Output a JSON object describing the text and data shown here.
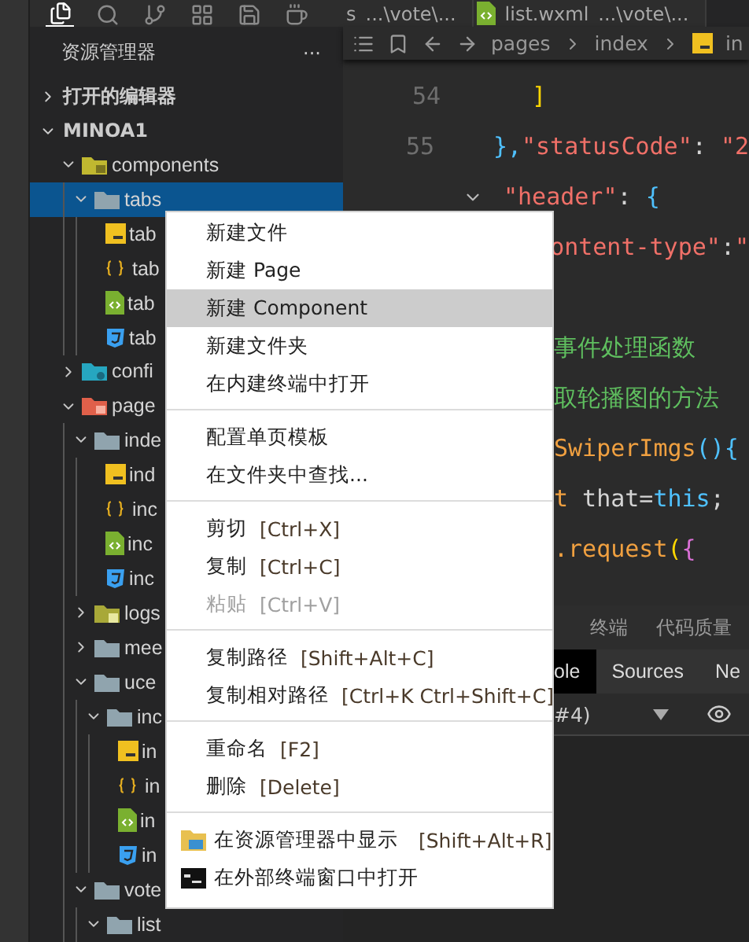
{
  "sidebar": {
    "toolbar": [
      {
        "kind": "files",
        "selected": true
      },
      {
        "kind": "search",
        "selected": false
      },
      {
        "kind": "git",
        "selected": false
      },
      {
        "kind": "extensions",
        "selected": false
      },
      {
        "kind": "save",
        "selected": false
      },
      {
        "kind": "cup",
        "selected": false
      }
    ],
    "title": "资源管理器",
    "more": "···",
    "sections": [
      {
        "label": "打开的编辑器",
        "expanded": false
      },
      {
        "label": "MINOA1",
        "expanded": true
      }
    ],
    "tree": [
      {
        "label": "components",
        "kind": "folder-components",
        "expanded": true,
        "selected": false,
        "children": [
          {
            "label": "tabs",
            "kind": "folder",
            "expanded": true,
            "selected": true,
            "children": [
              {
                "label": "tab",
                "kind": "js",
                "selected": false
              },
              {
                "label": "tab",
                "kind": "json",
                "selected": false
              },
              {
                "label": "tab",
                "kind": "wxml",
                "selected": false
              },
              {
                "label": "tab",
                "kind": "wxss",
                "selected": false
              }
            ]
          }
        ]
      },
      {
        "label": "confi",
        "kind": "folder-config",
        "expanded": false,
        "selected": false
      },
      {
        "label": "page",
        "kind": "folder-pages",
        "expanded": true,
        "selected": false,
        "children": [
          {
            "label": "inde",
            "kind": "folder",
            "expanded": true,
            "selected": false,
            "children": [
              {
                "label": "ind",
                "kind": "js",
                "selected": false
              },
              {
                "label": "inc",
                "kind": "json",
                "selected": false
              },
              {
                "label": "inc",
                "kind": "wxml",
                "selected": false
              },
              {
                "label": "inc",
                "kind": "wxss",
                "selected": false
              }
            ]
          },
          {
            "label": "logs",
            "kind": "folder-logs",
            "expanded": false,
            "selected": false
          },
          {
            "label": "mee",
            "kind": "folder",
            "expanded": false,
            "selected": false
          },
          {
            "label": "uce",
            "kind": "folder",
            "expanded": true,
            "selected": false,
            "children": [
              {
                "label": "inc",
                "kind": "folder",
                "expanded": true,
                "selected": false,
                "children": [
                  {
                    "label": "in",
                    "kind": "js",
                    "selected": false
                  },
                  {
                    "label": "in",
                    "kind": "json",
                    "selected": false
                  },
                  {
                    "label": "in",
                    "kind": "wxml",
                    "selected": false
                  },
                  {
                    "label": "in",
                    "kind": "wxss",
                    "selected": false
                  }
                ]
              }
            ]
          },
          {
            "label": "vote",
            "kind": "folder",
            "expanded": true,
            "selected": false,
            "children": [
              {
                "label": "list",
                "kind": "folder",
                "expanded": true,
                "selected": false
              }
            ]
          }
        ]
      }
    ]
  },
  "editor": {
    "tabs": [
      {
        "name": "s",
        "path": "...\\vote\\...",
        "kind": "js"
      },
      {
        "name": "list.wxml",
        "path": "...\\vote\\...",
        "kind": "wxml"
      }
    ],
    "breadcrumb": [
      "pages",
      "index",
      "in"
    ],
    "lines": [
      {
        "number": "54",
        "kind": "code",
        "tokens": [
          {
            "kind": "bracket1",
            "text": "  ]"
          }
        ]
      },
      {
        "number": "55",
        "kind": "code",
        "tokens": [
          {
            "kind": "bracket3",
            "text": "},"
          },
          {
            "kind": "key",
            "text": "\"statusCode\""
          },
          {
            "kind": "plain",
            "text": ": "
          },
          {
            "kind": "key",
            "text": "\"2"
          }
        ]
      },
      {
        "kind": "code",
        "foldable": true,
        "tokens": [
          {
            "kind": "key",
            "text": "\"header\""
          },
          {
            "kind": "plain",
            "text": ": "
          },
          {
            "kind": "bracket3",
            "text": "{"
          }
        ]
      },
      {
        "kind": "covered",
        "tokens": [
          {
            "kind": "key",
            "text": "ontent-type\""
          },
          {
            "kind": "plain",
            "text": ":"
          },
          {
            "kind": "key",
            "text": "\""
          }
        ]
      },
      {
        "kind": "blank"
      },
      {
        "kind": "covered",
        "tokens": [
          {
            "kind": "comment",
            "text": "事件处理函数"
          }
        ]
      },
      {
        "kind": "covered",
        "tokens": [
          {
            "kind": "comment",
            "text": "取轮播图的方法"
          }
        ]
      },
      {
        "kind": "covered",
        "tokens": [
          {
            "kind": "func",
            "text": "SwiperImgs"
          },
          {
            "kind": "bracket3",
            "text": "(){"
          }
        ]
      },
      {
        "kind": "covered",
        "tokens": [
          {
            "kind": "keyword",
            "text": "t"
          },
          {
            "kind": "plain",
            "text": " that="
          },
          {
            "kind": "builtin",
            "text": "this"
          },
          {
            "kind": "plain",
            "text": ";"
          }
        ]
      },
      {
        "kind": "covered",
        "tokens": [
          {
            "kind": "func",
            "text": ".request"
          },
          {
            "kind": "bracket1",
            "text": "("
          },
          {
            "kind": "bracket2",
            "text": "{"
          }
        ]
      }
    ]
  },
  "panel": {
    "tabs": [
      "终端",
      "代码质量"
    ],
    "devtools_tabs": [
      {
        "label": "ole",
        "selected": true
      },
      {
        "label": "Sources",
        "selected": false
      },
      {
        "label": "Ne",
        "selected": false
      }
    ],
    "context": "#4)"
  },
  "context_menu": {
    "groups": [
      [
        {
          "label": "新建文件",
          "selected": false,
          "disabled": false
        },
        {
          "label": "新建 Page",
          "selected": false,
          "disabled": false
        },
        {
          "label": "新建 Component",
          "selected": true,
          "disabled": false
        },
        {
          "label": "新建文件夹",
          "selected": false,
          "disabled": false
        },
        {
          "label": "在内建终端中打开",
          "selected": false,
          "disabled": false
        }
      ],
      [
        {
          "label": "配置单页模板",
          "selected": false,
          "disabled": false
        },
        {
          "label": "在文件夹中查找...",
          "selected": false,
          "disabled": false
        }
      ],
      [
        {
          "label": "剪切",
          "shortcut": "[Ctrl+X]",
          "selected": false,
          "disabled": false
        },
        {
          "label": "复制",
          "shortcut": "[Ctrl+C]",
          "selected": false,
          "disabled": false
        },
        {
          "label": "粘贴",
          "shortcut": "[Ctrl+V]",
          "selected": false,
          "disabled": true
        }
      ],
      [
        {
          "label": "复制路径",
          "shortcut": "[Shift+Alt+C]",
          "selected": false,
          "disabled": false
        },
        {
          "label": "复制相对路径",
          "shortcut": "[Ctrl+K Ctrl+Shift+C]",
          "selected": false,
          "disabled": false
        }
      ],
      [
        {
          "label": "重命名",
          "shortcut": "[F2]",
          "selected": false,
          "disabled": false
        },
        {
          "label": "删除",
          "shortcut": "[Delete]",
          "selected": false,
          "disabled": false
        }
      ],
      [
        {
          "label": "在资源管理器中显示",
          "shortcut": "[Shift+Alt+R]",
          "kind": "explorer",
          "selected": false,
          "disabled": false
        },
        {
          "label": "在外部终端窗口中打开",
          "kind": "terminal",
          "selected": false,
          "disabled": false
        }
      ]
    ]
  }
}
